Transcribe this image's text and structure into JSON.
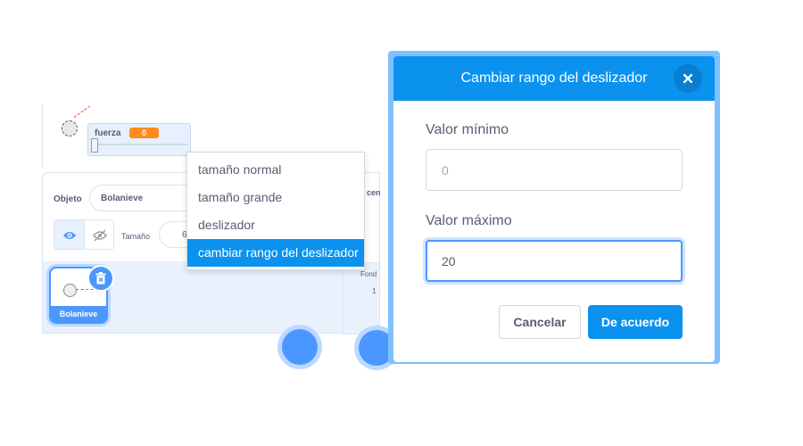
{
  "stage": {
    "monitor": {
      "label": "fuerza",
      "value": "0",
      "slider_fraction": 0
    }
  },
  "sprite_info": {
    "object_label": "Objeto",
    "sprite_name": "Bolanieve",
    "size_label": "Tamaño",
    "size_value_partial": "6"
  },
  "sprite_list": {
    "sprites": [
      {
        "name": "Bolanieve",
        "selected": true
      }
    ]
  },
  "stage_pane": {
    "header_partial": "cen",
    "backdrop_label": "Fond",
    "backdrop_count": "1"
  },
  "context_menu": {
    "items": [
      {
        "label": "tamaño normal"
      },
      {
        "label": "tamaño grande"
      },
      {
        "label": "deslizador"
      },
      {
        "label": "cambiar rango del deslizador",
        "active": true
      }
    ]
  },
  "dialog": {
    "title": "Cambiar rango del deslizador",
    "min_label": "Valor mínimo",
    "min_value": "",
    "min_placeholder": "0",
    "max_label": "Valor máximo",
    "max_value": "20",
    "cancel_label": "Cancelar",
    "ok_label": "De acuerdo"
  },
  "colors": {
    "accent": "#0b92ef",
    "sprite_blue": "#4c97ff",
    "monitor_orange": "#ff8c1a",
    "text": "#575e75"
  },
  "icons": {
    "close": "close-icon",
    "eye": "eye-icon",
    "eye_slash": "eye-slash-icon",
    "trash": "trash-icon"
  }
}
